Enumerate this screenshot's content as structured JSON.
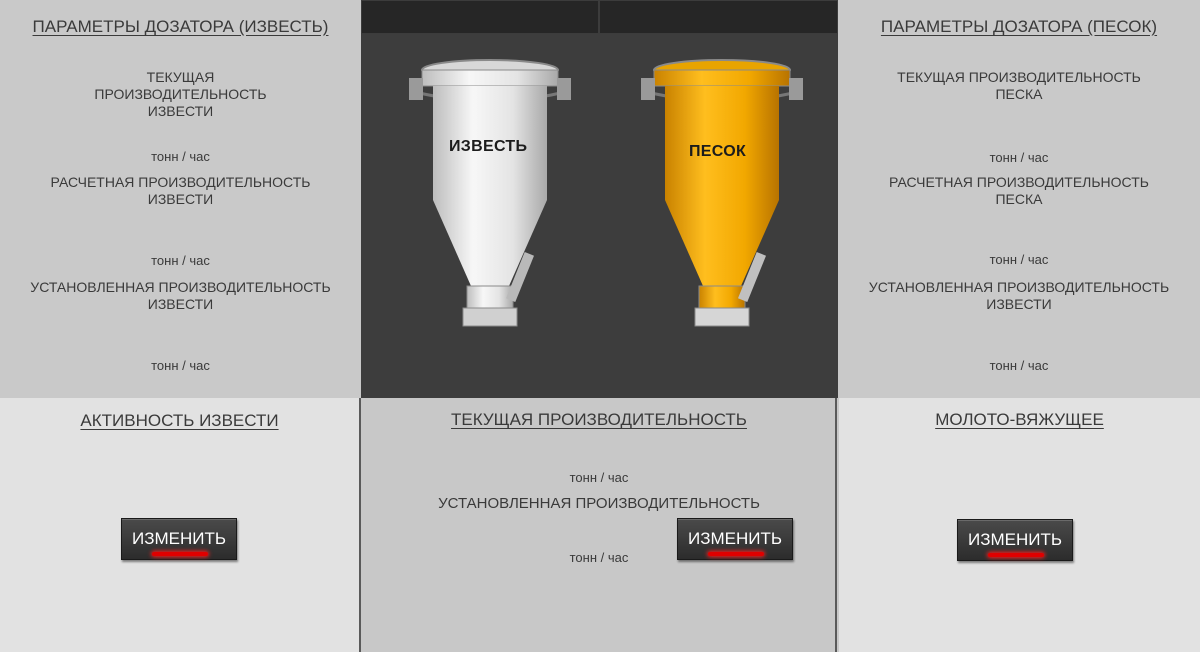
{
  "left": {
    "title": "ПАРАМЕТРЫ ДОЗАТОРА (ИЗВЕСТЬ)",
    "current_label": "ТЕКУЩАЯ ПРОИЗВОДИТЕЛЬНОСТЬ ИЗВЕСТИ",
    "calc_label": "РАСЧЕТНАЯ ПРОИЗВОДИТЕЛЬНОСТЬ ИЗВЕСТИ",
    "set_label": "УСТАНОВЛЕННАЯ ПРОИЗВОДИТЕЛЬНОСТЬ ИЗВЕСТИ",
    "unit": "тонн / час"
  },
  "right": {
    "title": "ПАРАМЕТРЫ ДОЗАТОРА (ПЕСОК)",
    "current_label": "ТЕКУЩАЯ ПРОИЗВОДИТЕЛЬНОСТЬ ПЕСКА",
    "calc_label": "РАСЧЕТНАЯ ПРОИЗВОДИТЕЛЬНОСТЬ ПЕСКА",
    "set_label": "УСТАНОВЛЕННАЯ ПРОИЗВОДИТЕЛЬНОСТЬ ИЗВЕСТИ",
    "unit": "тонн / час"
  },
  "center": {
    "lime_label": "ИЗВЕСТЬ",
    "sand_label": "ПЕСОК",
    "lime_color": "#ececec",
    "sand_color": "#f2a800"
  },
  "bottom_left": {
    "title": "АКТИВНОСТЬ ИЗВЕСТИ",
    "button": "ИЗМЕНИТЬ"
  },
  "bottom_center": {
    "title": "ТЕКУЩАЯ ПРОИЗВОДИТЕЛЬНОСТЬ",
    "unit_current": "тонн / час",
    "set_label": "УСТАНОВЛЕННАЯ ПРОИЗВОДИТЕЛЬНОСТЬ",
    "unit_set": "тонн / час",
    "button": "ИЗМЕНИТЬ"
  },
  "bottom_right": {
    "title": "МОЛОТО-ВЯЖУЩЕЕ",
    "button": "ИЗМЕНИТЬ"
  }
}
